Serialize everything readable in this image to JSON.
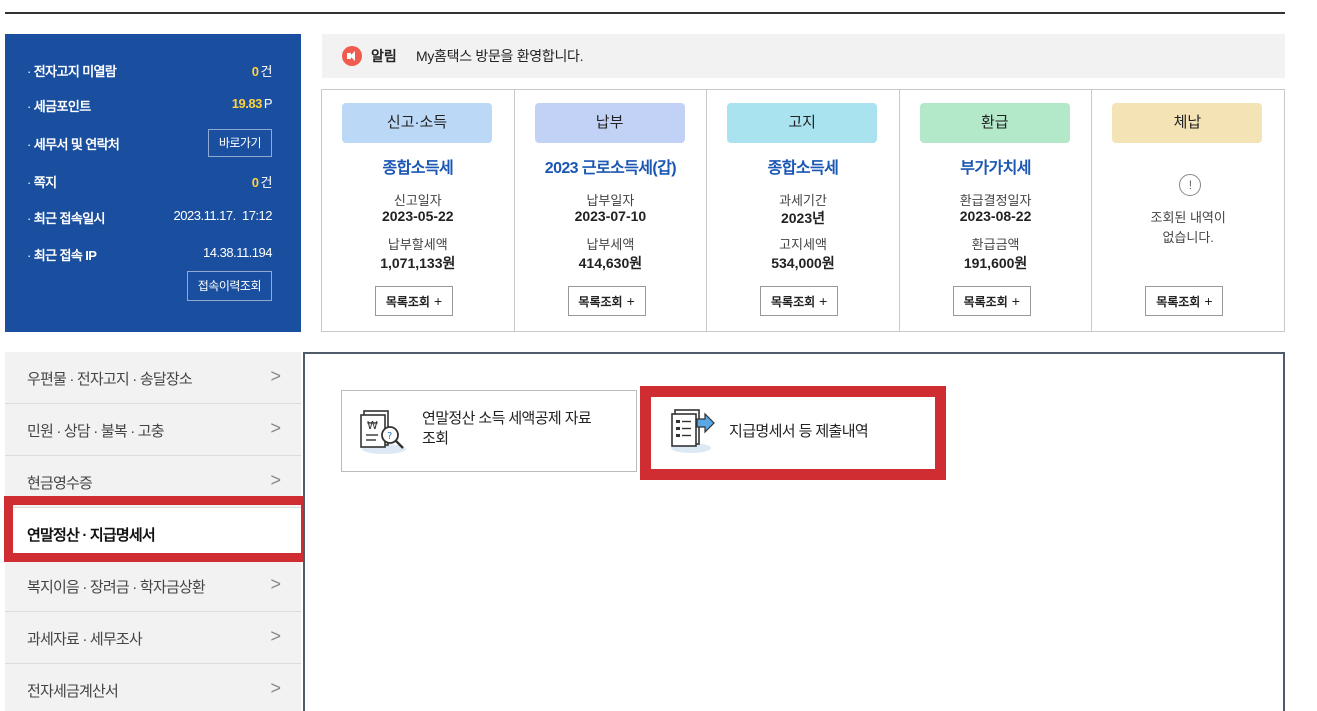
{
  "info": {
    "unread_label": "전자고지 미열람",
    "unread_value": "0",
    "unread_unit": "건",
    "points_label": "세금포인트",
    "points_value": "19.83",
    "points_unit": "P",
    "office_label": "세무서 및 연락처",
    "office_button": "바로가기",
    "memo_label": "쪽지",
    "memo_value": "0",
    "memo_unit": "건",
    "last_login_label": "최근 접속일시",
    "last_login_value": "2023.11.17.  17:12",
    "last_ip_label": "최근 접속 IP",
    "last_ip_value": "14.38.11.194",
    "history_button": "접속이력조회"
  },
  "notice": {
    "title": "알림",
    "text": "My홈택스 방문을 환영합니다."
  },
  "cards": [
    {
      "category": "신고·소득",
      "color": "#bcd8f7",
      "tax": "종합소득세",
      "label1": "신고일자",
      "value1": "2023-05-22",
      "label2": "납부할세액",
      "value2": "1,071,133원",
      "button": "목록조회",
      "plus": "+"
    },
    {
      "category": "납부",
      "color": "#c2d2f7",
      "tax": "2023 근로소득세(갑)",
      "label1": "납부일자",
      "value1": "2023-07-10",
      "label2": "납부세액",
      "value2": "414,630원",
      "button": "목록조회",
      "plus": "+"
    },
    {
      "category": "고지",
      "color": "#a9e3ef",
      "tax": "종합소득세",
      "label1": "과세기간",
      "value1": "2023년",
      "label2": "고지세액",
      "value2": "534,000원",
      "button": "목록조회",
      "plus": "+"
    },
    {
      "category": "환급",
      "color": "#b3e8c9",
      "tax": "부가가치세",
      "label1": "환급결정일자",
      "value1": "2023-08-22",
      "label2": "환급금액",
      "value2": "191,600원",
      "button": "목록조회",
      "plus": "+"
    },
    {
      "category": "체납",
      "color": "#f4e3b5",
      "alert": "!",
      "nodata1": "조회된 내역이",
      "nodata2": "없습니다.",
      "button": "목록조회",
      "plus": "+"
    }
  ],
  "menu": [
    {
      "label": "우편물 · 전자고지 · 송달장소",
      "chev": ">"
    },
    {
      "label": "민원 · 상담 · 불복 · 고충",
      "chev": ">"
    },
    {
      "label": "현금영수증",
      "chev": ">"
    },
    {
      "label": "연말정산 · 지급명세서",
      "chev": ""
    },
    {
      "label": "복지이음 · 장려금 · 학자금상환",
      "chev": ">"
    },
    {
      "label": "과세자료 · 세무조사",
      "chev": ">"
    },
    {
      "label": "전자세금계산서",
      "chev": ">"
    }
  ],
  "tiles": [
    {
      "line1": "연말정산 소득 세액공제 자료",
      "line2": "조회",
      "icon": "receipt-search-icon"
    },
    {
      "line1": "지급명세서 등 제출내역",
      "icon": "document-send-icon"
    }
  ]
}
